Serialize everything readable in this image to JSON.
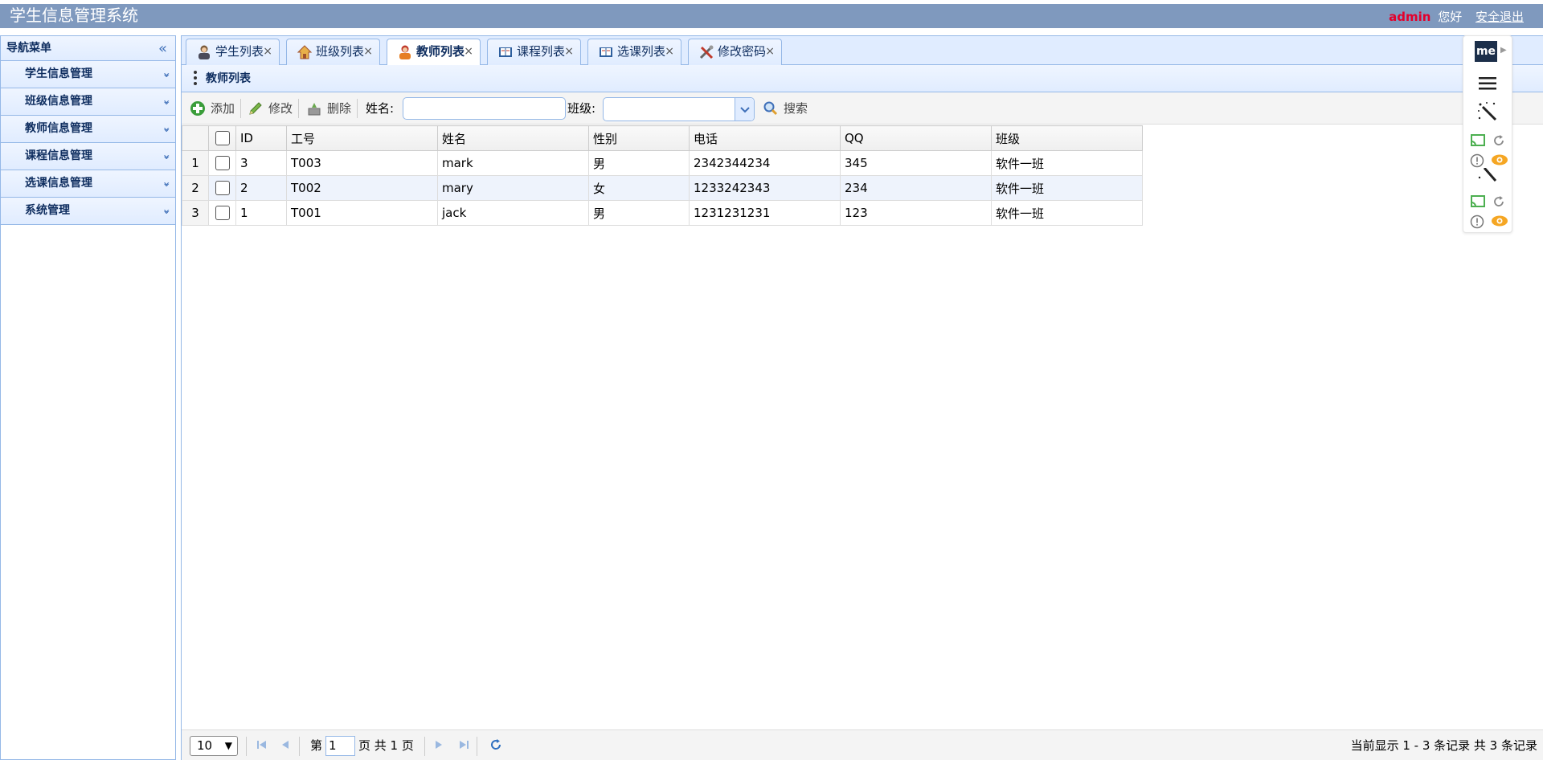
{
  "header": {
    "title": "学生信息管理系统",
    "username": "admin",
    "greeting": "您好",
    "logout": "安全退出"
  },
  "nav": {
    "title": "导航菜单",
    "items": [
      {
        "label": "学生信息管理"
      },
      {
        "label": "班级信息管理"
      },
      {
        "label": "教师信息管理"
      },
      {
        "label": "课程信息管理"
      },
      {
        "label": "选课信息管理"
      },
      {
        "label": "系统管理"
      }
    ]
  },
  "tabs": [
    {
      "label": "学生列表",
      "icon": "student-icon",
      "active": false
    },
    {
      "label": "班级列表",
      "icon": "house-icon",
      "active": false
    },
    {
      "label": "教师列表",
      "icon": "teacher-icon",
      "active": true
    },
    {
      "label": "课程列表",
      "icon": "book-icon",
      "active": false
    },
    {
      "label": "选课列表",
      "icon": "book-icon",
      "active": false
    },
    {
      "label": "修改密码",
      "icon": "tools-icon",
      "active": false
    }
  ],
  "panel": {
    "title": "教师列表"
  },
  "toolbar": {
    "add_label": "添加",
    "edit_label": "修改",
    "delete_label": "删除",
    "name_label": "姓名:",
    "class_label": "班级:",
    "search_label": "搜索",
    "name_value": "",
    "class_value": ""
  },
  "grid": {
    "columns": [
      "ID",
      "工号",
      "姓名",
      "性别",
      "电话",
      "QQ",
      "班级"
    ],
    "rows": [
      {
        "num": "1",
        "cells": [
          "3",
          "T003",
          "mark",
          "男",
          "2342344234",
          "345",
          "软件一班"
        ]
      },
      {
        "num": "2",
        "cells": [
          "2",
          "T002",
          "mary",
          "女",
          "1233242343",
          "234",
          "软件一班"
        ]
      },
      {
        "num": "3",
        "cells": [
          "1",
          "T001",
          "jack",
          "男",
          "1231231231",
          "123",
          "软件一班"
        ]
      }
    ]
  },
  "pager": {
    "page_size": "10",
    "page_prefix": "第",
    "page_number": "1",
    "page_suffix": "页 共 1 页",
    "info": "当前显示 1 - 3 条记录 共 3 条记录"
  },
  "extension": {
    "logo": "me"
  },
  "colors": {
    "header_bg": "#7f99be",
    "accent_border": "#95b8e7",
    "panel_header": "#e0ecff",
    "username": "#e4002b"
  }
}
